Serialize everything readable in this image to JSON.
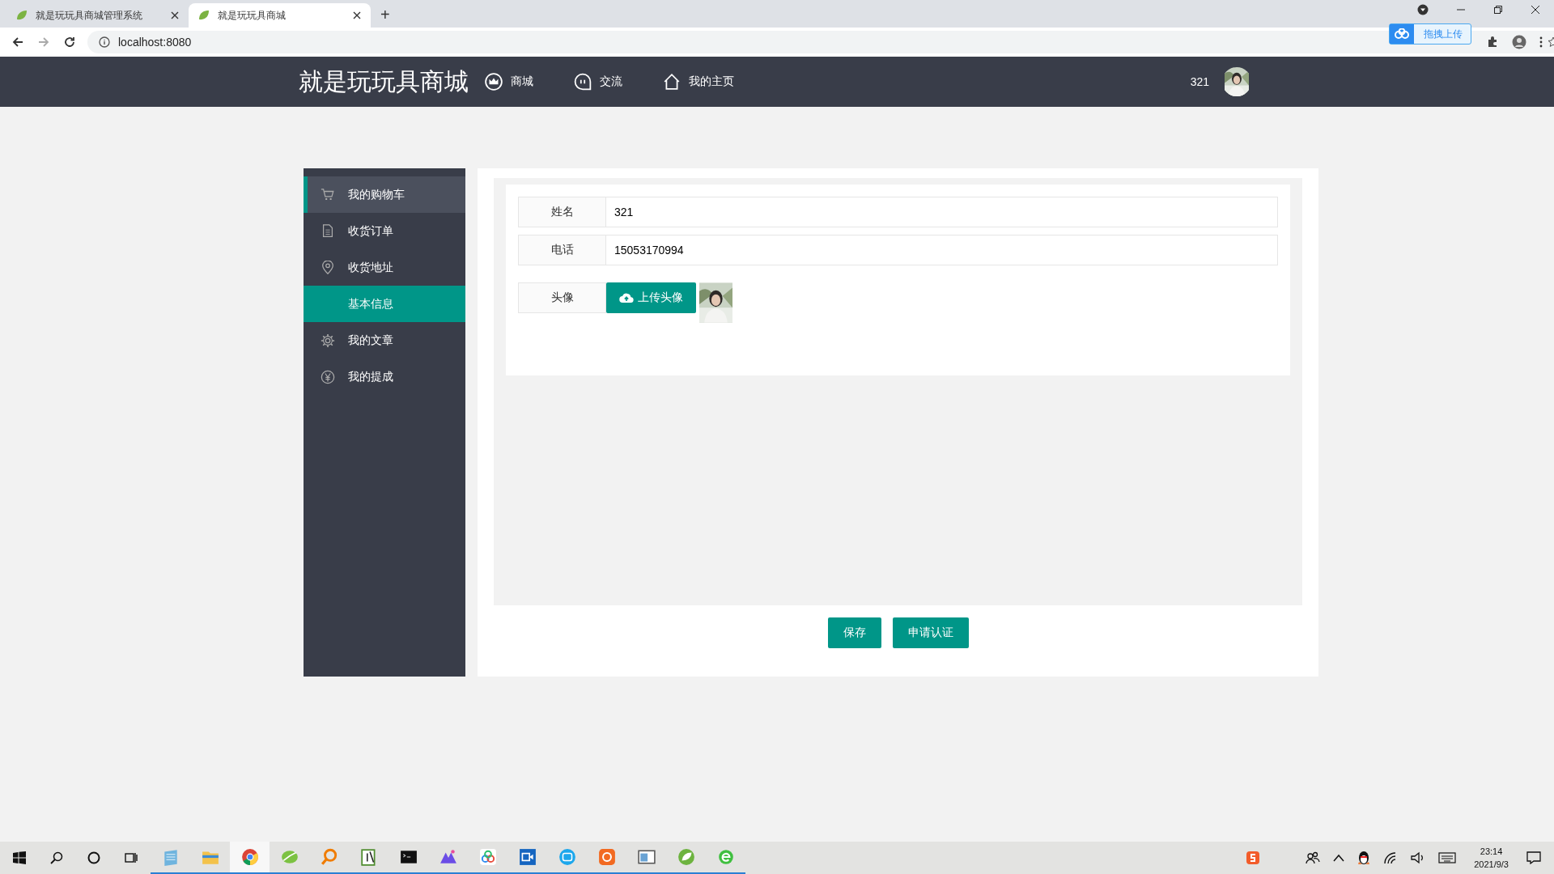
{
  "browser": {
    "tabs": [
      {
        "title": "就是玩玩具商城管理系统",
        "selected": false
      },
      {
        "title": "就是玩玩具商城",
        "selected": true
      }
    ],
    "new_tab": "+",
    "url": "localhost:8080",
    "extension_button": "拖拽上传"
  },
  "header": {
    "logo": "就是玩玩具商城",
    "nav": [
      {
        "kind": "crown",
        "label": "商城"
      },
      {
        "kind": "chat",
        "label": "交流"
      },
      {
        "kind": "home",
        "label": "我的主页"
      }
    ],
    "username": "321"
  },
  "sidebar": {
    "items": [
      {
        "kind": "cart",
        "label": "我的购物车",
        "selected": false,
        "hovered": true
      },
      {
        "kind": "doc",
        "label": "收货订单",
        "selected": false,
        "hovered": false
      },
      {
        "kind": "pin",
        "label": "收货地址",
        "selected": false,
        "hovered": false
      },
      {
        "kind": "none",
        "label": "基本信息",
        "selected": true,
        "hovered": false
      },
      {
        "kind": "gear",
        "label": "我的文章",
        "selected": false,
        "hovered": false
      },
      {
        "kind": "yen",
        "label": "我的提成",
        "selected": false,
        "hovered": false
      }
    ]
  },
  "form": {
    "fields": [
      {
        "label": "姓名",
        "value": "321"
      },
      {
        "label": "电话",
        "value": "15053170994"
      }
    ],
    "avatar_row": {
      "label": "头像",
      "upload_button": "上传头像"
    },
    "buttons": [
      "保存",
      "申请认证"
    ]
  },
  "taskbar": {
    "apps": [
      {
        "kind": "notepad",
        "running": true,
        "active": false
      },
      {
        "kind": "folder",
        "running": true,
        "active": false
      },
      {
        "kind": "chrome",
        "running": true,
        "active": true
      },
      {
        "kind": "leaf",
        "running": true,
        "active": false
      },
      {
        "kind": "magnifier",
        "running": true,
        "active": false
      },
      {
        "kind": "editor",
        "running": true,
        "active": false
      },
      {
        "kind": "terminal",
        "running": true,
        "active": false
      },
      {
        "kind": "mountain",
        "running": true,
        "active": false
      },
      {
        "kind": "cloud",
        "running": true,
        "active": false
      },
      {
        "kind": "video",
        "running": true,
        "active": false
      },
      {
        "kind": "bubble",
        "running": true,
        "active": false
      },
      {
        "kind": "sun",
        "running": true,
        "active": false
      },
      {
        "kind": "window",
        "running": true,
        "active": false
      },
      {
        "kind": "spring",
        "running": true,
        "active": false
      },
      {
        "kind": "ie",
        "running": true,
        "active": false
      }
    ],
    "time": "23:14",
    "date": "2021/9/3"
  }
}
